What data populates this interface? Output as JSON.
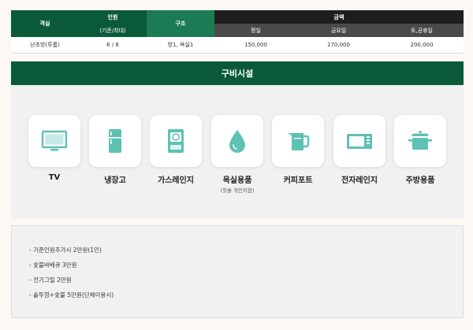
{
  "table": {
    "headers": {
      "room": "객실",
      "capacity": "인원",
      "capacity_sub": "(기준/최대)",
      "structure": "구조",
      "price": "금액",
      "weekday": "평일",
      "friday": "금요일",
      "weekend": "토,공휴일"
    },
    "row": {
      "room": "난초방(투룸)",
      "capacity": "6 / 8",
      "structure": "방1, 욕실1",
      "weekday": "150,000",
      "friday": "170,000",
      "weekend": "200,000"
    }
  },
  "facilities": {
    "title": "구비시설",
    "items": [
      {
        "label": "TV",
        "icon": "tv-icon"
      },
      {
        "label": "냉장고",
        "icon": "fridge-icon"
      },
      {
        "label": "가스레인지",
        "icon": "gas-range-icon"
      },
      {
        "label": "욕실용품",
        "sub": "(칫솔 개인지참)",
        "icon": "water-drop-icon"
      },
      {
        "label": "커피포트",
        "icon": "kettle-icon"
      },
      {
        "label": "전자레인지",
        "icon": "microwave-icon"
      },
      {
        "label": "주방용품",
        "icon": "pot-icon"
      }
    ],
    "icon_color": "#5dc1b4"
  },
  "notes": [
    "- 기준인원추가시 2만원(1인)",
    "- 숯불바베큐 3만원",
    "- 전기그릴 2만원",
    "- 솥뚜껑+숯불 5만원(단체이용시)"
  ],
  "colors": {
    "primary_green": "#0a5a3a",
    "secondary_green": "#1c7a55",
    "dark_header": "#1e1e1e",
    "grey_header": "#4a4a4a"
  }
}
